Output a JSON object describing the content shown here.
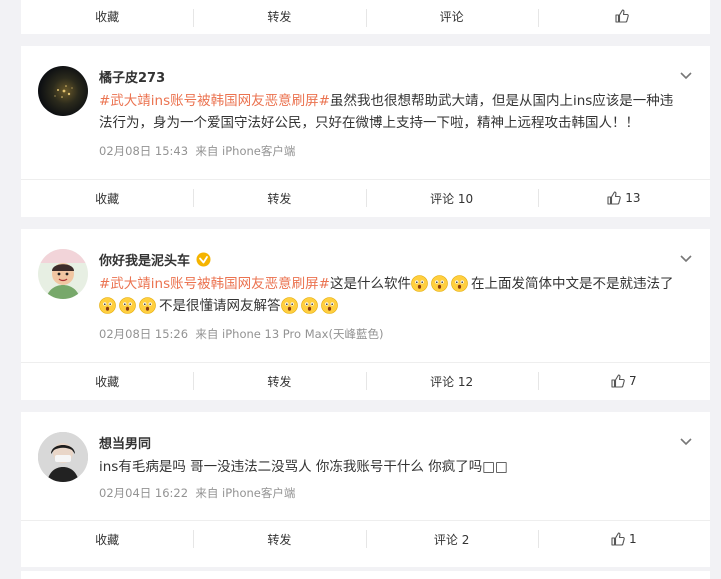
{
  "actions_top": {
    "collect": "收藏",
    "repost": "转发",
    "comment": "评论",
    "like": ""
  },
  "posts": [
    {
      "user": "橘子皮273",
      "tag": "#武大靖ins账号被韩国网友恶意刷屏#",
      "text": "虽然我也很想帮助武大靖，但是从国内上ins应该是一种违法行为，身为一个爱国守法好公民，只好在微博上支持一下啦，精神上远程攻击韩国人！！",
      "time": "02月08日 15:43",
      "source": "来自 iPhone客户端",
      "collect": "收藏",
      "repost": "转发",
      "comment": "评论 10",
      "likes": "13"
    },
    {
      "user": "你好我是泥头车",
      "tag": "#武大靖ins账号被韩国网友恶意刷屏#",
      "text_a": "这是什么软件",
      "text_b": "在上面发简体中文是不是就违法了",
      "text_c": "不是很懂请网友解答",
      "time": "02月08日 15:26",
      "source": "来自 iPhone 13 Pro Max(天峰藍色)",
      "collect": "收藏",
      "repost": "转发",
      "comment": "评论 12",
      "likes": "7"
    },
    {
      "user": "想当男同",
      "text": "ins有毛病是吗 哥一没违法二没骂人 你冻我账号干什么 你疯了吗□□",
      "time": "02月04日 16:22",
      "source": "来自 iPhone客户端",
      "collect": "收藏",
      "repost": "转发",
      "comment": "评论 2",
      "likes": "1"
    }
  ],
  "colors": {
    "tag": "#eb7350",
    "meta": "#939393",
    "verified": "#f5b400",
    "bg": "#f2f2f5"
  },
  "icons": {
    "like": "thumbs-up-icon",
    "more": "chevron-down-icon",
    "emoji": "thinking-face-emoji",
    "verified": "verified-badge-icon"
  }
}
